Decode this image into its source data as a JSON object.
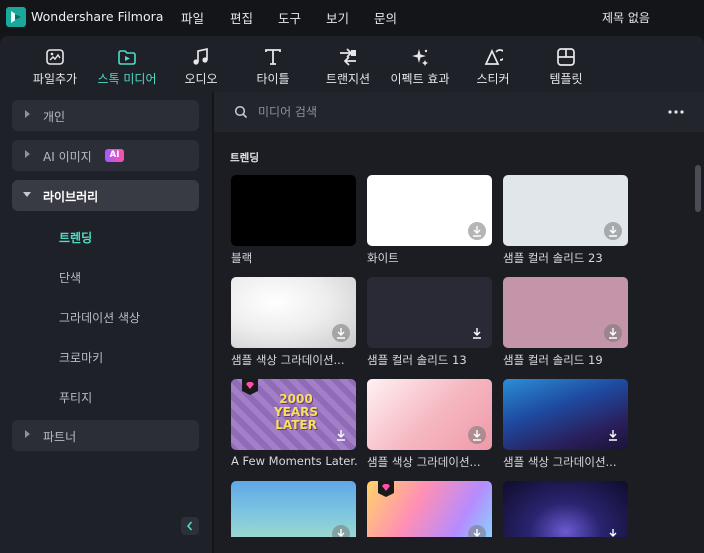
{
  "app": {
    "name": "Wondershare Filmora",
    "document_title": "제목 없음"
  },
  "menu": [
    "파일",
    "편집",
    "도구",
    "보기",
    "문의"
  ],
  "toolbar": {
    "items": [
      {
        "label": "파일추가",
        "icon": "import-icon"
      },
      {
        "label": "스톡 미디어",
        "icon": "stock-media-icon",
        "active": true
      },
      {
        "label": "오디오",
        "icon": "music-note-icon"
      },
      {
        "label": "타이틀",
        "icon": "title-t-icon"
      },
      {
        "label": "트랜지션",
        "icon": "transition-icon"
      },
      {
        "label": "이펙트 효과",
        "icon": "effects-sparkle-icon"
      },
      {
        "label": "스티커",
        "icon": "sticker-icon"
      },
      {
        "label": "템플릿",
        "icon": "template-icon"
      }
    ],
    "accent": "#4fdcc5"
  },
  "sidebar": {
    "groups": [
      {
        "label": "개인",
        "expanded": false
      },
      {
        "label": "AI 이미지",
        "badge": "AI",
        "expanded": false
      },
      {
        "label": "라이브러리",
        "expanded": true
      },
      {
        "label": "파트너",
        "expanded": false
      }
    ],
    "library_items": [
      "트렌딩",
      "단색",
      "그라데이션 색상",
      "크로마키",
      "푸티지"
    ],
    "selected": "트렌딩"
  },
  "search": {
    "placeholder": "미디어 검색"
  },
  "content": {
    "section_title": "트렌딩",
    "items": [
      {
        "caption": "블랙",
        "color": "#000000"
      },
      {
        "caption": "화이트",
        "color": "#ffffff"
      },
      {
        "caption": "샘플 컬러 솔리드 23",
        "color": "#e0e6ea"
      },
      {
        "caption": "샘플 색상 그라데이션...",
        "color": "gradient-white-gray"
      },
      {
        "caption": "샘플 컬러 솔리드 13",
        "color": "#2a2936"
      },
      {
        "caption": "샘플 컬러 솔리드 19",
        "color": "#c495a8"
      },
      {
        "caption": "A Few Moments Later...",
        "thumbnail_text": "2000 YEARS LATER",
        "premium": true
      },
      {
        "caption": "샘플 색상 그라데이션...",
        "color": "gradient-pink"
      },
      {
        "caption": "샘플 색상 그라데이션...",
        "color": "gradient-blue-night"
      }
    ]
  }
}
